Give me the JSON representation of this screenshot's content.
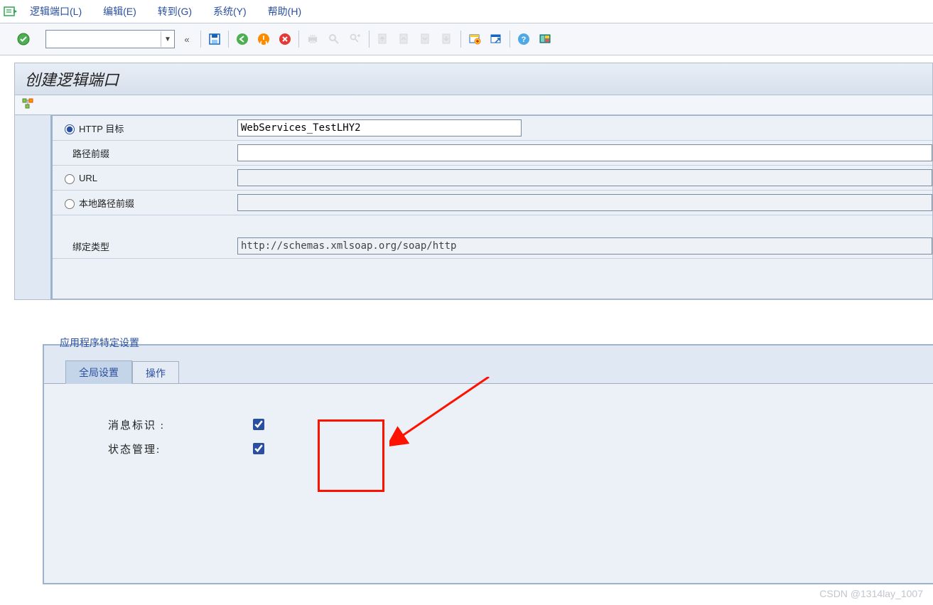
{
  "menu": {
    "logical_port": "逻辑端口(L)",
    "edit": "编辑(E)",
    "goto": "转到(G)",
    "system": "系统(Y)",
    "help": "帮助(H)"
  },
  "toolbar": {
    "back_glyph": "«"
  },
  "page": {
    "title": "创建逻辑端口"
  },
  "form": {
    "http_target_label": "HTTP 目标",
    "http_target_value": "WebServices_TestLHY2",
    "path_prefix_label": "路径前缀",
    "path_prefix_value": "",
    "url_label": "URL",
    "url_value": "",
    "local_path_prefix_label": "本地路径前缀",
    "local_path_prefix_value": "",
    "binding_type_label": "绑定类型",
    "binding_type_value": "http://schemas.xmlsoap.org/soap/http"
  },
  "app_settings": {
    "group_title": "应用程序特定设置",
    "tabs": {
      "global": "全局设置",
      "ops": "操作"
    },
    "msg_id_label": "消息标识 :",
    "state_mgmt_label": "状态管理:"
  },
  "watermark": "CSDN @1314lay_1007",
  "icons": {
    "ok": "ok-icon",
    "save": "save-icon",
    "back": "back-icon",
    "exit": "exit-icon",
    "cancel": "cancel-icon",
    "print": "print-icon",
    "find": "find-icon",
    "findnext": "find-next-icon",
    "first": "first-page-icon",
    "prev": "prev-page-icon",
    "next": "next-page-icon",
    "last": "last-page-icon",
    "create": "create-session-icon",
    "shortcut": "shortcut-icon",
    "help2": "help-icon",
    "layout": "layout-icon",
    "tree": "tree-icon"
  }
}
